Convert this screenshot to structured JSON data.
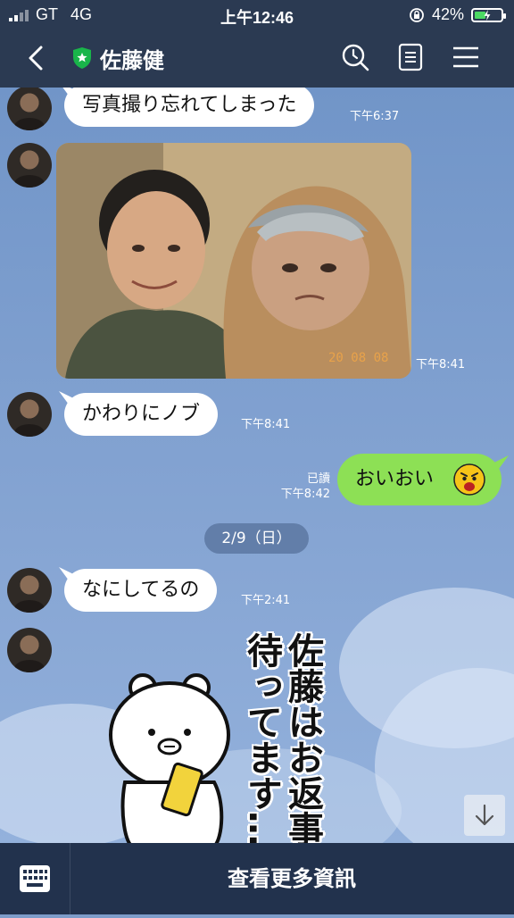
{
  "status": {
    "carrier": "GT",
    "network": "4G",
    "time": "上午12:46",
    "battery": "42%",
    "battery_level": 0.42
  },
  "header": {
    "contact_name": "佐藤健"
  },
  "messages": [
    {
      "text": "写真撮り忘れてしまった",
      "time": "下午6:37"
    },
    {
      "photo_stamp": "20 08 08",
      "time": "下午8:41"
    },
    {
      "text": "かわりにノブ",
      "time": "下午8:41"
    },
    {
      "text": "おいおい",
      "read": "已讀",
      "time": "下午8:42"
    },
    {
      "text": "なにしてるの",
      "time": "下午2:41"
    }
  ],
  "date_separator": "2/9（日）",
  "sticker": {
    "line1": "佐藤はお返事",
    "line2": "待ってます…"
  },
  "bottom_bar": {
    "more_label": "查看更多資訊"
  }
}
